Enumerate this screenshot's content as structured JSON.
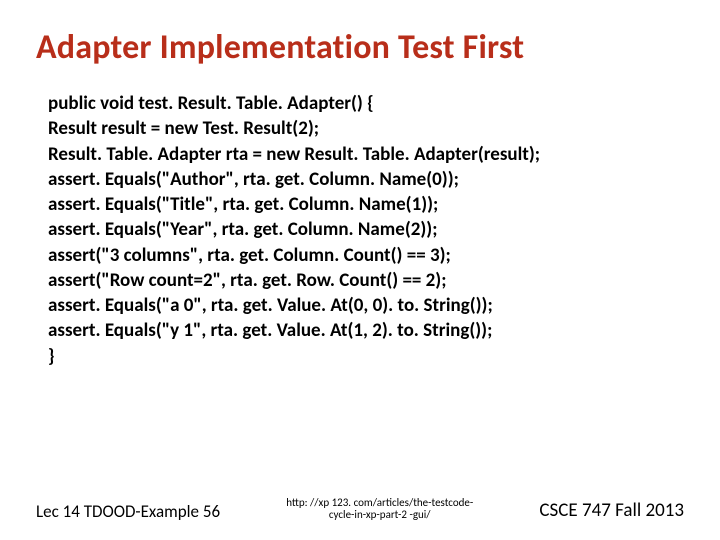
{
  "title": "Adapter Implementation Test First",
  "code": {
    "l0": "public void test. Result. Table. Adapter() {",
    "l1": "Result result = new Test. Result(2);",
    "l2": "Result. Table. Adapter rta = new Result. Table. Adapter(result);",
    "l3": "assert. Equals(\"Author\", rta. get. Column. Name(0));",
    "l4": "assert. Equals(\"Title\", rta. get. Column. Name(1));",
    "l5": "assert. Equals(\"Year\", rta. get. Column. Name(2));",
    "l6": "assert(\"3 columns\", rta. get. Column. Count() == 3);",
    "l7": "assert(\"Row count=2\", rta. get. Row. Count() == 2);",
    "l8": "assert. Equals(\"a 0\", rta. get. Value. At(0, 0). to. String());",
    "l9": "assert. Equals(\"y 1\", rta. get. Value. At(1, 2). to. String());",
    "l10": "}"
  },
  "footer": {
    "left": "Lec 14 TDOOD-Example 56",
    "mid_line1": "http: //xp 123. com/articles/the-testcode-",
    "mid_line2": "cycle-in-xp-part-2 -gui/",
    "right": "CSCE 747 Fall 2013"
  }
}
